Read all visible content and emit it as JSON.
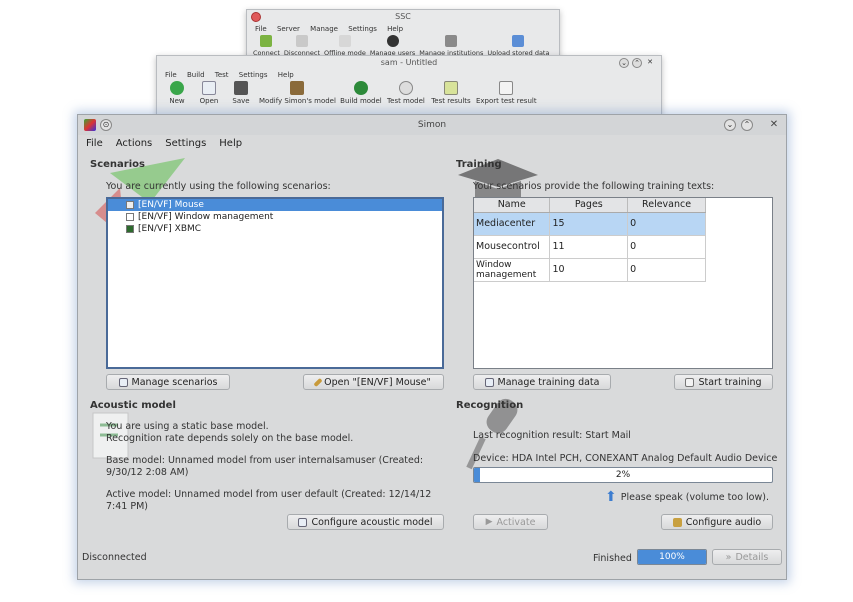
{
  "ssc_window": {
    "title": "SSC",
    "menu": [
      "File",
      "Server",
      "Manage",
      "Settings",
      "Help"
    ],
    "tools": [
      "Connect",
      "Disconnect",
      "Offline mode",
      "Manage users",
      "Manage institutions",
      "Upload stored data"
    ]
  },
  "sam_window": {
    "title": "sam - Untitled",
    "menu": [
      "File",
      "Build",
      "Test",
      "Settings",
      "Help"
    ],
    "tools": [
      "New",
      "Open",
      "Save",
      "Modify Simon's model",
      "Build model",
      "Test model",
      "Test results",
      "Export test result"
    ]
  },
  "main": {
    "title": "Simon",
    "menu": [
      "File",
      "Actions",
      "Settings",
      "Help"
    ],
    "scenarios": {
      "title": "Scenarios",
      "intro": "You are currently using the following scenarios:",
      "items": [
        "[EN/VF] Mouse",
        "[EN/VF] Window management",
        "[EN/VF] XBMC"
      ],
      "manage_button": "Manage scenarios",
      "open_button": "Open \"[EN/VF] Mouse\""
    },
    "training": {
      "title": "Training",
      "intro": "Your scenarios provide the following training texts:",
      "columns": [
        "Name",
        "Pages",
        "Relevance"
      ],
      "rows": [
        {
          "name": "Mediacenter",
          "pages": "15",
          "relevance": "0"
        },
        {
          "name": "Mousecontrol",
          "pages": "11",
          "relevance": "0"
        },
        {
          "name": "Window management",
          "pages": "10",
          "relevance": "0"
        }
      ],
      "manage_button": "Manage training data",
      "start_button": "Start training"
    },
    "acoustic": {
      "title": "Acoustic model",
      "line1": "You are using a static base model.",
      "line2": "Recognition rate depends solely on the base model.",
      "base1": "Base model: Unnamed model from user internalsamuser (Created:",
      "base2": "9/30/12 2:08 AM)",
      "active1": "Active model: Unnamed model from user default (Created: 12/14/12",
      "active2": "7:41 PM)",
      "configure_button": "Configure acoustic model"
    },
    "recognition": {
      "title": "Recognition",
      "last_result": "Last recognition result: Start Mail",
      "device": "Device: HDA Intel PCH, CONEXANT Analog Default Audio Device",
      "level_label": "2%",
      "level_fraction": 0.02,
      "speak_hint": "Please speak (volume too low).",
      "activate_button": "Activate",
      "configure_audio_button": "Configure audio"
    },
    "status": {
      "connection": "Disconnected",
      "finished_label": "Finished",
      "progress_label": "100%",
      "progress_fraction": 1.0,
      "details_button": "Details"
    }
  },
  "colors": {
    "selection": "#4a8cd8",
    "window_bg": "#d9dadb",
    "glow": "#5a82be"
  }
}
